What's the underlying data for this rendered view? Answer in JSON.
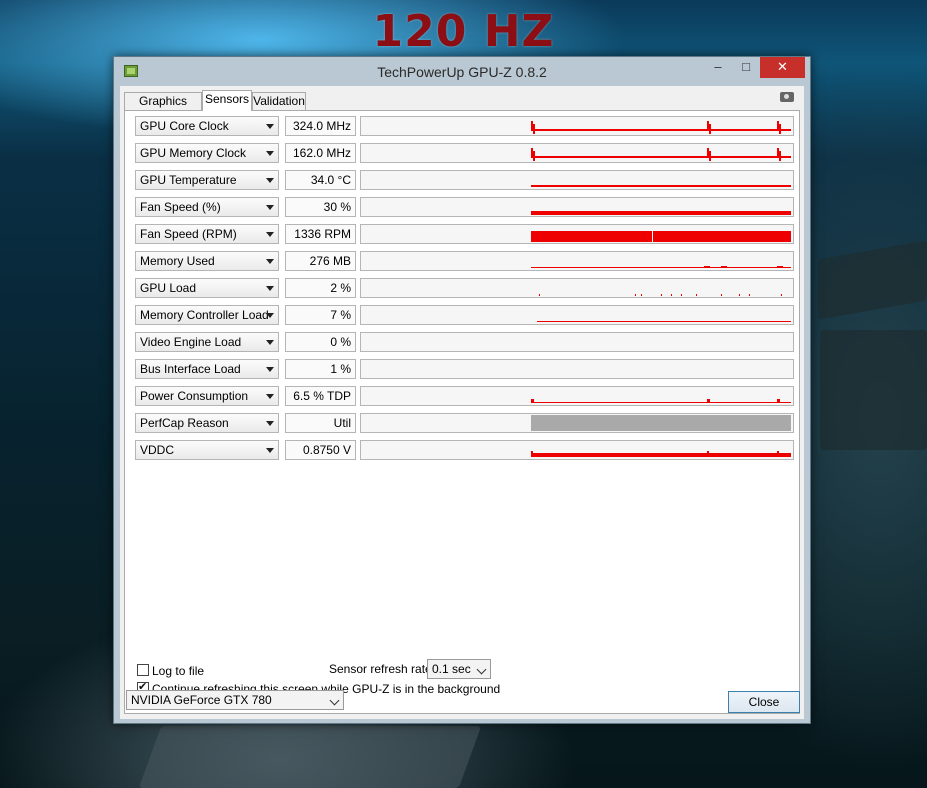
{
  "banner": "120 HZ",
  "window": {
    "title": "TechPowerUp GPU-Z 0.8.2",
    "minimize": "–",
    "maximize": "□",
    "close": "✕"
  },
  "tabs": [
    {
      "label": "Graphics Card",
      "active": false
    },
    {
      "label": "Sensors",
      "active": true
    },
    {
      "label": "Validation",
      "active": false
    }
  ],
  "screenshot_icon": "camera-icon",
  "sensors": [
    {
      "name": "GPU Core Clock",
      "value": "324.0 MHz",
      "graph": "spikes"
    },
    {
      "name": "GPU Memory Clock",
      "value": "162.0 MHz",
      "graph": "spikes"
    },
    {
      "name": "GPU Temperature",
      "value": "34.0 °C",
      "graph": "line"
    },
    {
      "name": "Fan Speed (%)",
      "value": "30 %",
      "graph": "line-thick"
    },
    {
      "name": "Fan Speed (RPM)",
      "value": "1336 RPM",
      "graph": "fill"
    },
    {
      "name": "Memory Used",
      "value": "276 MB",
      "graph": "thin"
    },
    {
      "name": "GPU Load",
      "value": "2 %",
      "graph": "dots"
    },
    {
      "name": "Memory Controller Load",
      "value": "7 %",
      "graph": "thin-low"
    },
    {
      "name": "Video Engine Load",
      "value": "0 %",
      "graph": "none"
    },
    {
      "name": "Bus Interface Load",
      "value": "1 %",
      "graph": "none"
    },
    {
      "name": "Power Consumption",
      "value": "6.5 % TDP",
      "graph": "spikes-low"
    },
    {
      "name": "PerfCap Reason",
      "value": "Util",
      "graph": "gray"
    },
    {
      "name": "VDDC",
      "value": "0.8750 V",
      "graph": "line-med"
    }
  ],
  "options": {
    "log_to_file": {
      "label": "Log to file",
      "checked": false
    },
    "continue_refresh": {
      "label": "Continue refreshing this screen while GPU-Z is in the background",
      "checked": true
    },
    "refresh_rate_label": "Sensor refresh rate:",
    "refresh_rate_value": "0.1 sec"
  },
  "gpu_select": "NVIDIA GeForce GTX 780",
  "close_button": "Close",
  "colors": {
    "graph": "#ee0000",
    "perfcap": "#a9a9a9"
  }
}
